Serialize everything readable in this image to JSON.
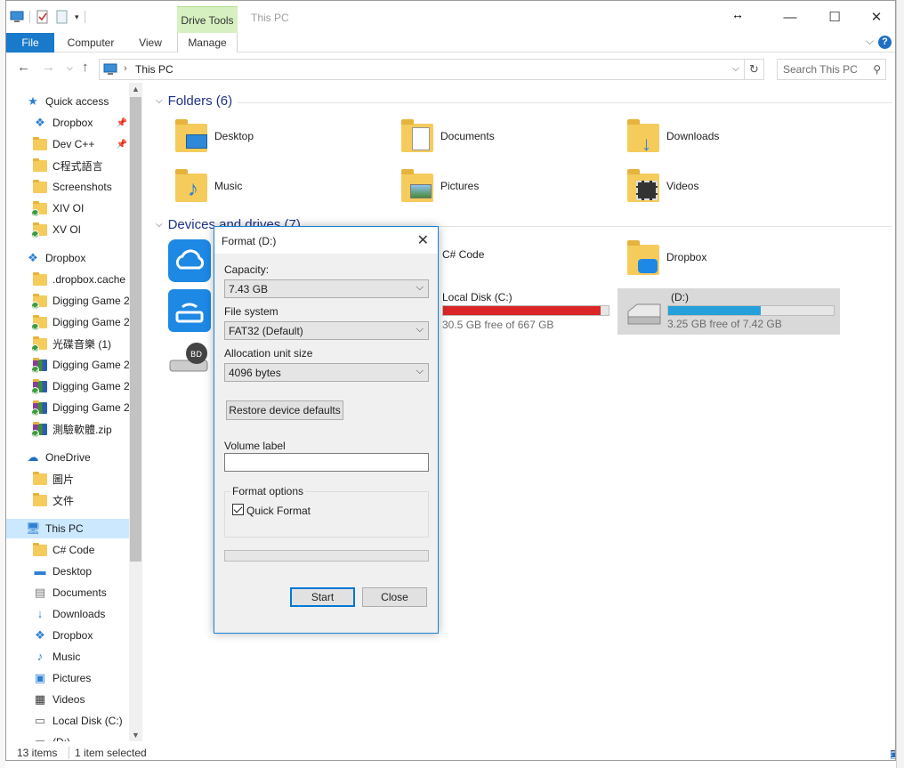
{
  "window": {
    "title": "This PC",
    "context_tab": "Drive Tools"
  },
  "ribbon": {
    "tabs": [
      "File",
      "Computer",
      "View",
      "Manage"
    ]
  },
  "address": {
    "path": "This PC",
    "search_placeholder": "Search This PC"
  },
  "nav": {
    "items": [
      {
        "label": "Quick access",
        "icon": "star-icon"
      },
      {
        "label": "Dropbox",
        "icon": "dropbox-icon",
        "pinned": true
      },
      {
        "label": "Dev C++",
        "icon": "folder-icon",
        "pinned": true
      },
      {
        "label": "C程式語言",
        "icon": "folder-icon"
      },
      {
        "label": "Screenshots",
        "icon": "folder-icon"
      },
      {
        "label": "XIV OI",
        "icon": "folder-synced-icon"
      },
      {
        "label": "XV OI",
        "icon": "folder-synced-icon"
      },
      {
        "label": "Dropbox",
        "icon": "dropbox-icon"
      },
      {
        "label": ".dropbox.cache",
        "icon": "folder-icon"
      },
      {
        "label": "Digging Game 2",
        "icon": "folder-synced-icon"
      },
      {
        "label": "Digging Game 2",
        "icon": "folder-synced-icon"
      },
      {
        "label": "光碟音樂 (1)",
        "icon": "folder-synced-icon"
      },
      {
        "label": "Digging Game 2",
        "icon": "archive-synced-icon"
      },
      {
        "label": "Digging Game 2",
        "icon": "archive-synced-icon"
      },
      {
        "label": "Digging Game 2",
        "icon": "archive-synced-icon"
      },
      {
        "label": "測驗軟體.zip",
        "icon": "archive-synced-icon"
      },
      {
        "label": "OneDrive",
        "icon": "cloud-icon"
      },
      {
        "label": "圖片",
        "icon": "folder-icon"
      },
      {
        "label": "文件",
        "icon": "folder-icon"
      },
      {
        "label": "This PC",
        "icon": "computer-icon",
        "selected": true
      },
      {
        "label": "C# Code",
        "icon": "folder-icon"
      },
      {
        "label": "Desktop",
        "icon": "desktop-icon"
      },
      {
        "label": "Documents",
        "icon": "documents-icon"
      },
      {
        "label": "Downloads",
        "icon": "download-icon"
      },
      {
        "label": "Dropbox",
        "icon": "dropbox-icon"
      },
      {
        "label": "Music",
        "icon": "music-icon"
      },
      {
        "label": "Pictures",
        "icon": "pictures-icon"
      },
      {
        "label": "Videos",
        "icon": "videos-icon"
      },
      {
        "label": "Local Disk (C:)",
        "icon": "disk-icon"
      },
      {
        "label": "(D:)",
        "icon": "disk-icon"
      }
    ]
  },
  "folders": {
    "header": "Folders (6)",
    "items": [
      "Desktop",
      "Documents",
      "Downloads",
      "Music",
      "Pictures",
      "Videos"
    ]
  },
  "devices": {
    "header": "Devices and drives (7)",
    "items": [
      {
        "label": "C# Code"
      },
      {
        "label": "Dropbox"
      },
      {
        "label": "Local Disk (C:)",
        "free": "30.5 GB free of 667 GB",
        "used_fraction": 0.95,
        "color": "#da2626"
      },
      {
        "label": "(D:)",
        "free": "3.25 GB free of 7.42 GB",
        "used_fraction": 0.56,
        "color": "#26a0da",
        "selected": true
      }
    ]
  },
  "status": {
    "count": "13 items",
    "selected": "1 item selected"
  },
  "dialog": {
    "title": "Format  (D:)",
    "capacity_label": "Capacity:",
    "capacity_value": "7.43 GB",
    "fs_label": "File system",
    "fs_value": "FAT32 (Default)",
    "alloc_label": "Allocation unit size",
    "alloc_value": "4096 bytes",
    "restore_btn": "Restore device defaults",
    "volume_label": "Volume label",
    "volume_value": "",
    "options_legend": "Format options",
    "quick_format": "Quick Format",
    "quick_checked": true,
    "progress": 0,
    "start_btn": "Start",
    "close_btn": "Close"
  }
}
